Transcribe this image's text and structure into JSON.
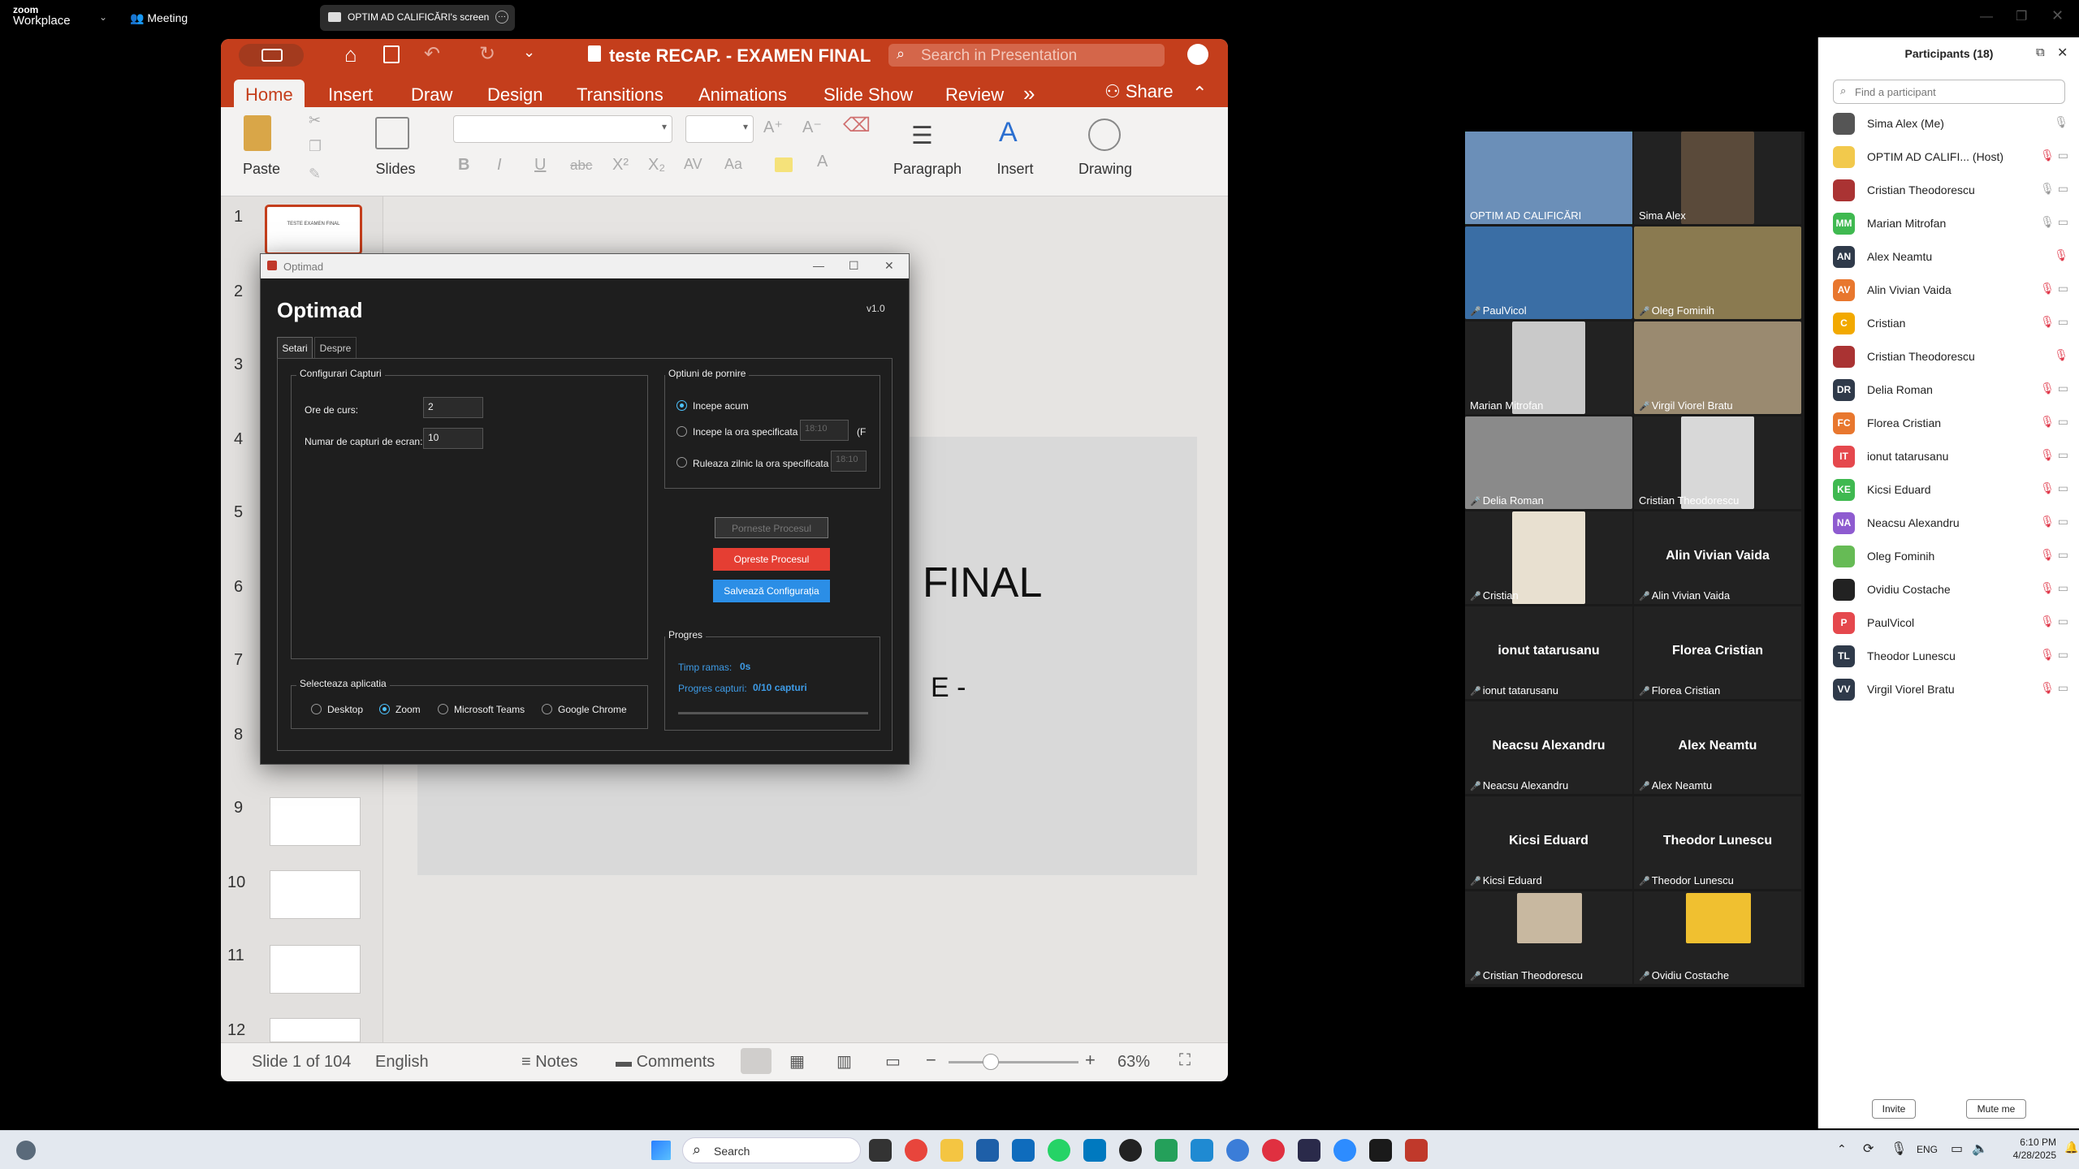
{
  "zoom_top": {
    "brand_line1": "zoom",
    "brand_line2": "Workplace",
    "meeting_label": "Meeting",
    "share_label": "OPTIM AD CALIFICĂRI's screen"
  },
  "ppt": {
    "doc_title": "teste RECAP. - EXAMEN FINAL",
    "search_placeholder": "Search in Presentation",
    "tabs": [
      "Home",
      "Insert",
      "Draw",
      "Design",
      "Transitions",
      "Animations",
      "Slide Show",
      "Review"
    ],
    "more_tabs": "»",
    "share_label": "Share",
    "ribbon": {
      "paste": "Paste",
      "slides": "Slides",
      "paragraph": "Paragraph",
      "insert": "Insert",
      "drawing": "Drawing"
    },
    "format_buttons": [
      "B",
      "I",
      "U",
      "abc",
      "X²",
      "X₂",
      "AV",
      "Aa",
      "A"
    ],
    "thumb_numbers": [
      "1",
      "2",
      "3",
      "4",
      "5",
      "6",
      "7",
      "8",
      "9",
      "10",
      "11",
      "12"
    ],
    "slide_text": {
      "title_fragment": "FINAL",
      "sub_fragment": "E -"
    },
    "thumb1_text": "TESTE EXAMEN FINAL",
    "status": {
      "slide": "Slide 1 of 104",
      "language": "English",
      "notes": "Notes",
      "comments": "Comments",
      "zoom": "63%"
    }
  },
  "optimad": {
    "window_title": "Optimad",
    "heading": "Optimad",
    "version": "v1.0",
    "tabs": [
      "Setari",
      "Despre"
    ],
    "config_frame": "Configurari Capturi",
    "ore_label": "Ore de curs:",
    "ore_value": "2",
    "capturi_label": "Numar de capturi de ecran:",
    "capturi_value": "10",
    "start_frame": "Optiuni de pornire",
    "opt_now": "Incepe acum",
    "opt_at": "Incepe la ora specificata",
    "opt_at_time": "18:10",
    "opt_at_suffix": "(F",
    "opt_daily": "Ruleaza zilnic la ora specificata",
    "opt_daily_time": "18:10",
    "btn_start": "Porneste Procesul",
    "btn_stop": "Opreste Procesul",
    "btn_save": "Salvează Configurația",
    "app_frame": "Selecteaza aplicatia",
    "apps": [
      "Desktop",
      "Zoom",
      "Microsoft Teams",
      "Google Chrome"
    ],
    "selected_app": "Zoom",
    "progress_frame": "Progres",
    "time_label": "Timp ramas:",
    "time_value": "0s",
    "cap_label": "Progres capturi:",
    "cap_value": "0/10 capturi",
    "progress": 0
  },
  "gallery": {
    "tiles": [
      {
        "name": "OPTIM AD CALIFICĂRI",
        "muted": false,
        "video": true
      },
      {
        "name": "Sima Alex",
        "muted": false,
        "video": true
      },
      {
        "name": "PaulVicol",
        "muted": true,
        "video": true
      },
      {
        "name": "Oleg Fominih",
        "muted": true,
        "video": true
      },
      {
        "name": "Marian Mitrofan",
        "muted": false,
        "video": true
      },
      {
        "name": "Virgil Viorel Bratu",
        "muted": true,
        "video": true
      },
      {
        "name": "Delia Roman",
        "muted": true,
        "video": true
      },
      {
        "name": "Cristian Theodorescu",
        "muted": false,
        "video": true
      },
      {
        "name": "Cristian",
        "muted": true,
        "video": true
      },
      {
        "name": "Alin Vivian Vaida",
        "muted": true,
        "video": false
      },
      {
        "name": "ionut tatarusanu",
        "muted": true,
        "video": false
      },
      {
        "name": "Florea Cristian",
        "muted": true,
        "video": false
      },
      {
        "name": "Neacsu Alexandru",
        "muted": true,
        "video": false
      },
      {
        "name": "Alex Neamtu",
        "muted": true,
        "video": false
      },
      {
        "name": "Kicsi Eduard",
        "muted": true,
        "video": false
      },
      {
        "name": "Theodor Lunescu",
        "muted": true,
        "video": false
      },
      {
        "name": "Cristian Theodorescu",
        "muted": true,
        "video": false,
        "avatar": true
      },
      {
        "name": "Ovidiu Costache",
        "muted": true,
        "video": false,
        "avatar": true
      }
    ]
  },
  "participants": {
    "title": "Participants (18)",
    "search_placeholder": "Find a participant",
    "items": [
      {
        "initials": "",
        "name": "Sima Alex (Me)",
        "color": "#555"
      },
      {
        "initials": "",
        "name": "OPTIM AD CALIFI...  (Host)",
        "color": "#f2c94c"
      },
      {
        "initials": "",
        "name": "Cristian Theodorescu",
        "color": "#a33"
      },
      {
        "initials": "MM",
        "name": "Marian Mitrofan",
        "color": "#3fb950"
      },
      {
        "initials": "AN",
        "name": "Alex Neamtu",
        "color": "#2f3a4a"
      },
      {
        "initials": "AV",
        "name": "Alin Vivian Vaida",
        "color": "#e8772e"
      },
      {
        "initials": "C",
        "name": "Cristian",
        "color": "#f2a900"
      },
      {
        "initials": "",
        "name": "Cristian Theodorescu",
        "color": "#a33"
      },
      {
        "initials": "DR",
        "name": "Delia Roman",
        "color": "#2f3a4a"
      },
      {
        "initials": "FC",
        "name": "Florea Cristian",
        "color": "#e8772e"
      },
      {
        "initials": "IT",
        "name": "ionut tatarusanu",
        "color": "#e5484d"
      },
      {
        "initials": "KE",
        "name": "Kicsi Eduard",
        "color": "#3fb950"
      },
      {
        "initials": "NA",
        "name": "Neacsu Alexandru",
        "color": "#8e5bd0"
      },
      {
        "initials": "",
        "name": "Oleg Fominih",
        "color": "#6b5"
      },
      {
        "initials": "",
        "name": "Ovidiu Costache",
        "color": "#222"
      },
      {
        "initials": "P",
        "name": "PaulVicol",
        "color": "#e5484d"
      },
      {
        "initials": "TL",
        "name": "Theodor Lunescu",
        "color": "#2f3a4a"
      },
      {
        "initials": "VV",
        "name": "Virgil Viorel Bratu",
        "color": "#2f3a4a"
      }
    ],
    "invite": "Invite",
    "mute_me": "Mute me"
  },
  "taskbar": {
    "search": "Search",
    "lang": "ENG",
    "time": "6:10 PM",
    "date": "4/28/2025"
  }
}
